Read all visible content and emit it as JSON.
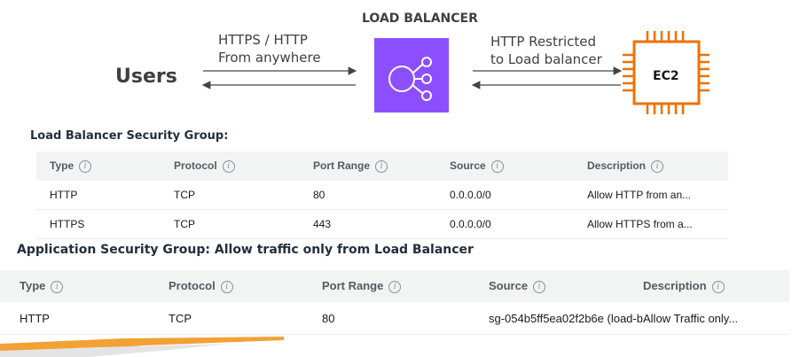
{
  "diagram": {
    "users_label": "Users",
    "lb_title": "LOAD BALANCER",
    "left_line1": "HTTPS / HTTP",
    "left_line2": "From anywhere",
    "right_line1": "HTTP Restricted",
    "right_line2": "to Load balancer",
    "ec2_label": "EC2",
    "lb_color": "#8c4fff",
    "ec2_color": "#ed7100"
  },
  "lb_sg": {
    "title": "Load Balancer Security Group:",
    "headers": [
      "Type",
      "Protocol",
      "Port Range",
      "Source",
      "Description"
    ],
    "rows": [
      [
        "HTTP",
        "TCP",
        "80",
        "0.0.0.0/0",
        "Allow HTTP from an..."
      ],
      [
        "HTTPS",
        "TCP",
        "443",
        "0.0.0.0/0",
        "Allow HTTPS from a..."
      ]
    ]
  },
  "app_sg": {
    "title": "Application Security Group: Allow traffic only from Load Balancer",
    "headers": [
      "Type",
      "Protocol",
      "Port Range",
      "Source",
      "Description"
    ],
    "rows": [
      [
        "HTTP",
        "TCP",
        "80",
        "sg-054b5ff5ea02f2b6e (load-b",
        "Allow Traffic only..."
      ]
    ]
  }
}
